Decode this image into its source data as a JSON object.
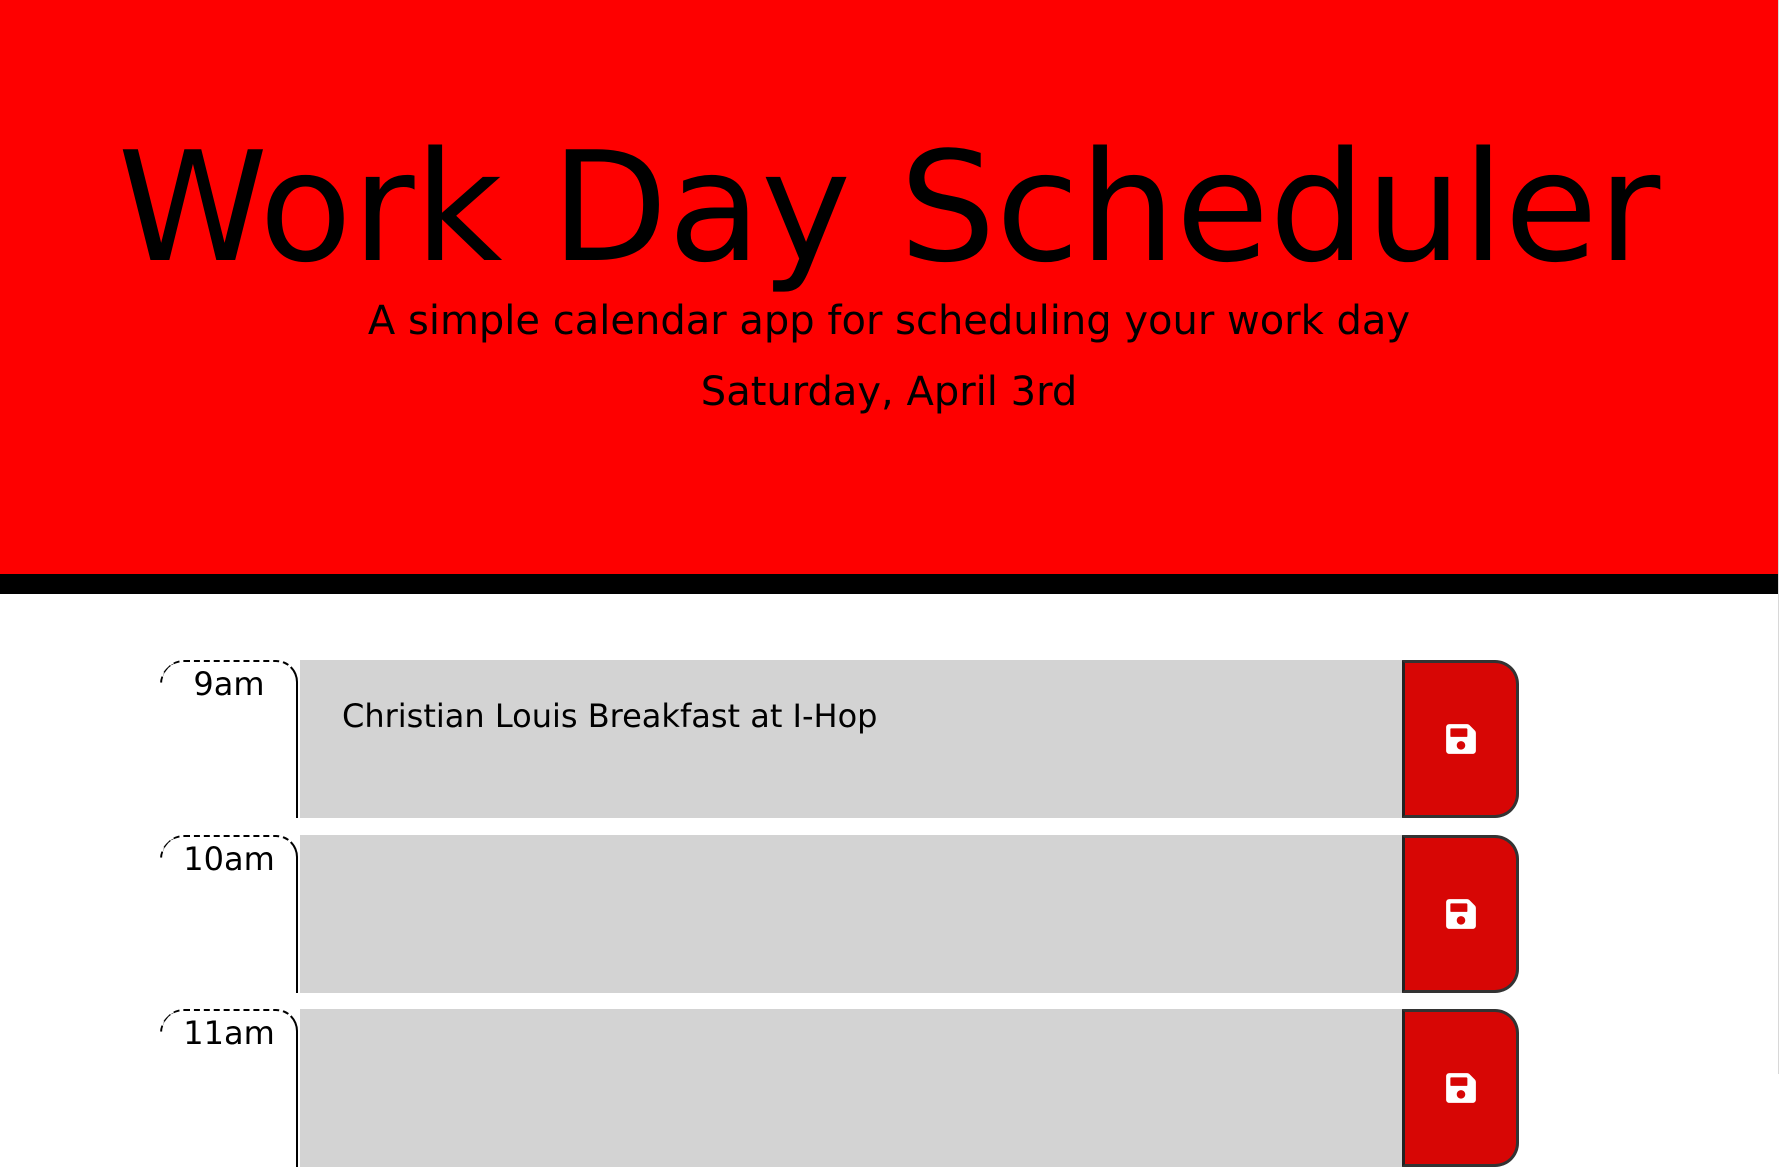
{
  "header": {
    "title": "Work Day Scheduler",
    "subtitle": "A simple calendar app for scheduling your work day",
    "current_day": "Saturday, April 3rd"
  },
  "colors": {
    "header_background": "#fe0000",
    "header_border": "#000000",
    "past_block": "#d3d3d3",
    "save_button": "#d70605"
  },
  "timeblocks": [
    {
      "hour": "9am",
      "description": "Christian Louis Breakfast at I-Hop",
      "save_icon": "save-icon"
    },
    {
      "hour": "10am",
      "description": "",
      "save_icon": "save-icon"
    },
    {
      "hour": "11am",
      "description": "",
      "save_icon": "save-icon"
    }
  ]
}
